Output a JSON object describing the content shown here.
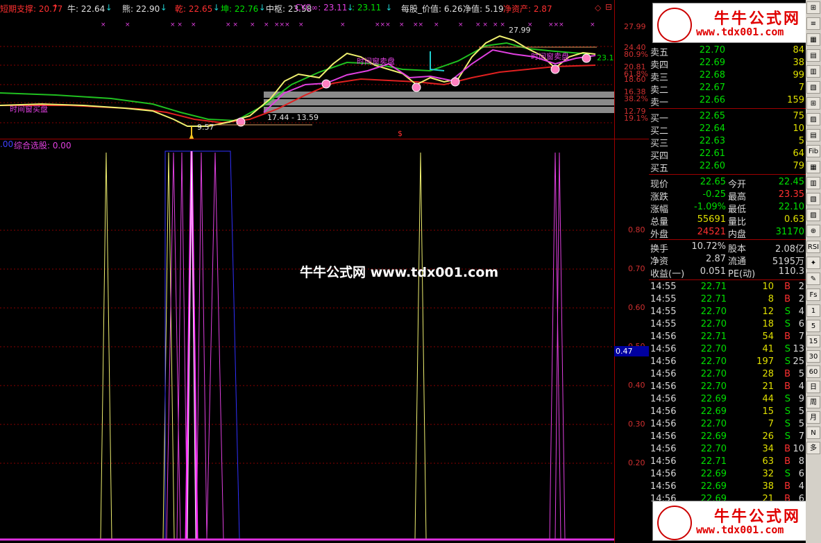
{
  "header": {
    "items": [
      {
        "label": "短期支撑: 20.77",
        "arrow": "↑",
        "color": "#ff3030"
      },
      {
        "label": "牛: 22.64",
        "arrow": "↓",
        "color": "#e0e0e0"
      },
      {
        "label": "熊: 22.90",
        "arrow": "↓",
        "color": "#e0e0e0"
      },
      {
        "label": "乾: 22.65",
        "arrow": "↓",
        "color": "#ff3030"
      },
      {
        "label": "坤: 22.76",
        "arrow": "↓",
        "color": "#00e000"
      },
      {
        "label": "中枢: 23.58",
        "arrow": "",
        "color": "#e0e0e0"
      },
      {
        "label": "CYC∞: 23.11",
        "arrow": "↓",
        "color": "#e040e0"
      },
      {
        "label": ": 23.11",
        "arrow": "↓",
        "color": "#00e000"
      },
      {
        "label": "每股_价值: 6.26",
        "arrow": "",
        "color": "#e0e0e0"
      },
      {
        "label": "净值: 5.19",
        "arrow": "",
        "color": "#e0e0e0"
      },
      {
        "label": "净资产: 2.87",
        "arrow": "",
        "color": "#ff3030"
      }
    ]
  },
  "upper_axis": {
    "labels": [
      "27.99",
      "24.40",
      "80.9%",
      "20.81",
      "61.8%",
      "18.60",
      "16.38",
      "38.2%",
      "12.79",
      "19.1%"
    ]
  },
  "upper_annotations": {
    "peak": "27.99",
    "low": "9.57",
    "range": "17.44 - 13.59",
    "sell_tag": "时间窗卖盘",
    "buy_tag": "时间窗买盘",
    "right_edge_value": "23.1",
    "dollar": "$"
  },
  "lower": {
    "title": "综合选股: 0.00",
    "left_value": ".00",
    "axis_labels": [
      "0.80",
      "0.70",
      "0.60",
      "0.50",
      "0.40",
      "0.30",
      "0.20"
    ],
    "current_value": "0.47"
  },
  "watermark": "牛牛公式网 www.tdx001.com",
  "logo": {
    "title": "牛牛公式网",
    "url": "www.tdx001.com"
  },
  "order_book": {
    "sell": [
      {
        "label": "卖五",
        "price": "22.70",
        "vol": "84"
      },
      {
        "label": "卖四",
        "price": "22.69",
        "vol": "38"
      },
      {
        "label": "卖三",
        "price": "22.68",
        "vol": "99"
      },
      {
        "label": "卖二",
        "price": "22.67",
        "vol": "7"
      },
      {
        "label": "卖一",
        "price": "22.66",
        "vol": "159"
      }
    ],
    "buy": [
      {
        "label": "买一",
        "price": "22.65",
        "vol": "75"
      },
      {
        "label": "买二",
        "price": "22.64",
        "vol": "10"
      },
      {
        "label": "买三",
        "price": "22.63",
        "vol": "5"
      },
      {
        "label": "买四",
        "price": "22.61",
        "vol": "64"
      },
      {
        "label": "买五",
        "price": "22.60",
        "vol": "79"
      }
    ]
  },
  "stats": [
    {
      "l1": "现价",
      "v1": "22.65",
      "c1": "g",
      "l2": "今开",
      "v2": "22.45",
      "c2": "g"
    },
    {
      "l1": "涨跌",
      "v1": "-0.25",
      "c1": "g",
      "l2": "最高",
      "v2": "23.35",
      "c2": "r"
    },
    {
      "l1": "涨幅",
      "v1": "-1.09%",
      "c1": "g",
      "l2": "最低",
      "v2": "22.10",
      "c2": "g"
    },
    {
      "l1": "总量",
      "v1": "55691",
      "c1": "y",
      "l2": "量比",
      "v2": "0.63",
      "c2": "y"
    },
    {
      "l1": "外盘",
      "v1": "24521",
      "c1": "r",
      "l2": "内盘",
      "v2": "31170",
      "c2": "g"
    },
    {
      "l1": "换手",
      "v1": "10.72%",
      "c1": "w",
      "l2": "股本",
      "v2": "2.08亿",
      "c2": "w"
    },
    {
      "l1": "净资",
      "v1": "2.87",
      "c1": "w",
      "l2": "流通",
      "v2": "5195万",
      "c2": "w"
    },
    {
      "l1": "收益(一)",
      "v1": "0.051",
      "c1": "w",
      "l2": "PE(动)",
      "v2": "110.3",
      "c2": "w"
    }
  ],
  "ticks": [
    {
      "t": "14:55",
      "p": "22.71",
      "v": "10",
      "s": "B",
      "n": "2"
    },
    {
      "t": "14:55",
      "p": "22.71",
      "v": "8",
      "s": "B",
      "n": "2"
    },
    {
      "t": "14:55",
      "p": "22.70",
      "v": "12",
      "s": "S",
      "n": "4"
    },
    {
      "t": "14:55",
      "p": "22.70",
      "v": "18",
      "s": "S",
      "n": "6"
    },
    {
      "t": "14:56",
      "p": "22.71",
      "v": "54",
      "s": "B",
      "n": "7"
    },
    {
      "t": "14:56",
      "p": "22.70",
      "v": "41",
      "s": "S",
      "n": "13"
    },
    {
      "t": "14:56",
      "p": "22.70",
      "v": "197",
      "s": "S",
      "n": "25"
    },
    {
      "t": "14:56",
      "p": "22.70",
      "v": "28",
      "s": "B",
      "n": "5"
    },
    {
      "t": "14:56",
      "p": "22.70",
      "v": "21",
      "s": "B",
      "n": "4"
    },
    {
      "t": "14:56",
      "p": "22.69",
      "v": "44",
      "s": "S",
      "n": "9"
    },
    {
      "t": "14:56",
      "p": "22.69",
      "v": "15",
      "s": "S",
      "n": "5"
    },
    {
      "t": "14:56",
      "p": "22.70",
      "v": "7",
      "s": "S",
      "n": "5"
    },
    {
      "t": "14:56",
      "p": "22.69",
      "v": "26",
      "s": "S",
      "n": "7"
    },
    {
      "t": "14:56",
      "p": "22.70",
      "v": "34",
      "s": "B",
      "n": "10"
    },
    {
      "t": "14:56",
      "p": "22.71",
      "v": "63",
      "s": "B",
      "n": "8"
    },
    {
      "t": "14:56",
      "p": "22.69",
      "v": "32",
      "s": "S",
      "n": "6"
    },
    {
      "t": "14:56",
      "p": "22.69",
      "v": "38",
      "s": "B",
      "n": "4"
    },
    {
      "t": "14:56",
      "p": "22.69",
      "v": "21",
      "s": "B",
      "n": "6"
    }
  ],
  "sidebar": {
    "buttons": [
      "⊞",
      "≡",
      "▦",
      "▤",
      "▥",
      "▧",
      "⊞",
      "▨",
      "▤",
      "Fib",
      "▦",
      "▥",
      "▧",
      "▨",
      "⊕",
      "RSI",
      "✦",
      "✎",
      "Fs",
      "1",
      "5",
      "15",
      "30",
      "60",
      "日",
      "周",
      "月",
      "N",
      "多"
    ]
  },
  "top_controls": [
    "◇",
    "⊟"
  ]
}
